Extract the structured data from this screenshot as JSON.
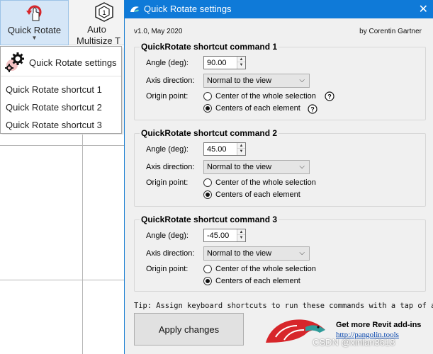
{
  "ribbon": {
    "quick_rotate_label": "Quick Rotate",
    "auto_label_1": "Auto",
    "auto_label_2": "Multisize T"
  },
  "menu": {
    "header": "Quick Rotate settings",
    "items": [
      "Quick Rotate shortcut 1",
      "Quick Rotate shortcut 2",
      "Quick Rotate shortcut 3"
    ]
  },
  "dialog": {
    "title": "Quick Rotate settings",
    "close": "✕",
    "version": "v1.0, May 2020",
    "author": "by Corentin Gartner",
    "groups": [
      {
        "title": "QuickRotate shortcut command 1",
        "angle_label": "Angle (deg):",
        "angle": "90.00",
        "axis_label": "Axis direction:",
        "axis": "Normal to the view",
        "origin_label": "Origin point:",
        "option_whole": "Center of the whole selection",
        "option_each": "Centers of each element",
        "selected": "each"
      },
      {
        "title": "QuickRotate shortcut command 2",
        "angle_label": "Angle (deg):",
        "angle": "45.00",
        "axis_label": "Axis direction:",
        "axis": "Normal to the view",
        "origin_label": "Origin point:",
        "option_whole": "Center of the whole selection",
        "option_each": "Centers of each element",
        "selected": "each"
      },
      {
        "title": "QuickRotate shortcut command 3",
        "angle_label": "Angle (deg):",
        "angle": "-45.00",
        "axis_label": "Axis direction:",
        "axis": "Normal to the view",
        "origin_label": "Origin point:",
        "option_whole": "Center of the whole selection",
        "option_each": "Centers of each element",
        "selected": "each"
      }
    ],
    "tip": "Tip: Assign keyboard shortcuts to run these commands with a tap of a",
    "apply_label": "Apply changes",
    "brand_line1": "Get more Revit add-ins",
    "brand_line2": "http://pangolin.tools",
    "watermark": "CSDN @xinlan3618"
  },
  "colors": {
    "titlebar": "#0f7ad8",
    "pangolin_red": "#d7262b",
    "pangolin_teal": "#2e9c9a"
  }
}
